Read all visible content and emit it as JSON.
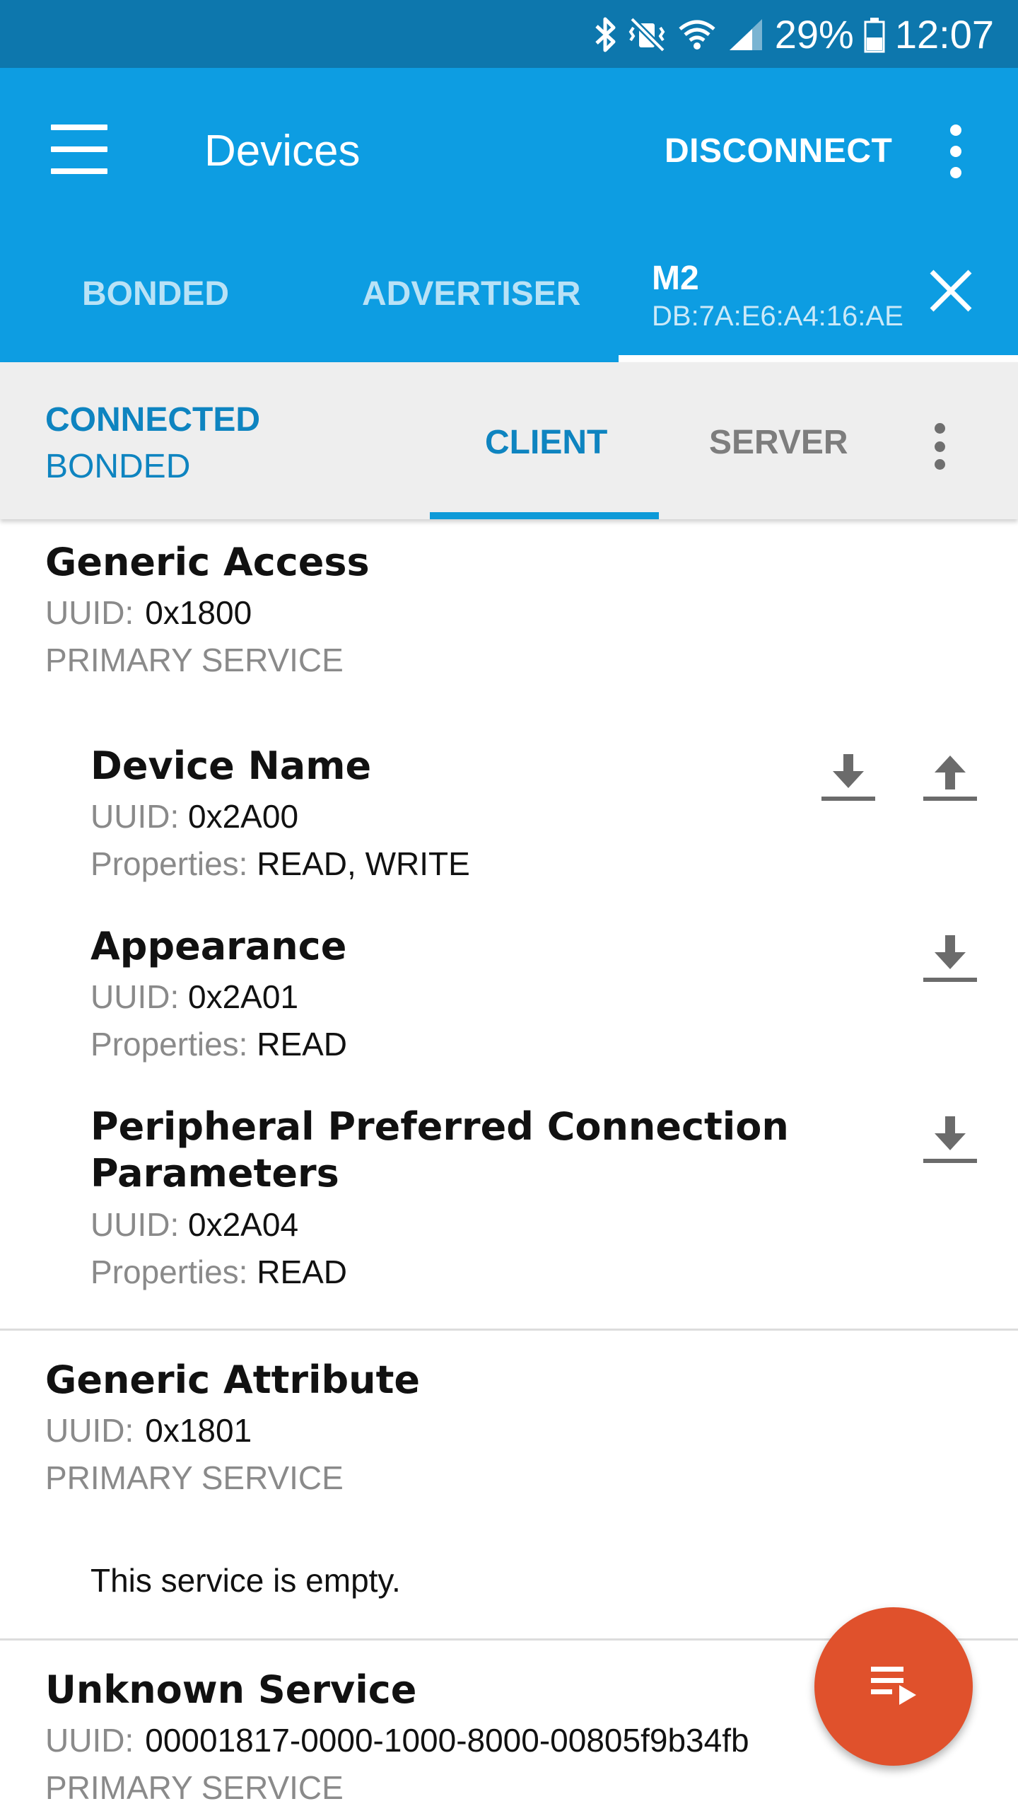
{
  "status_bar": {
    "battery": "29%",
    "time": "12:07",
    "icons": [
      "bluetooth-icon",
      "vibrate-icon",
      "wifi-icon",
      "cell-signal-icon",
      "battery-icon"
    ]
  },
  "app_bar": {
    "title": "Devices",
    "disconnect_label": "DISCONNECT",
    "tabs": [
      {
        "label": "BONDED"
      },
      {
        "label": "ADVERTISER"
      }
    ],
    "device_tab": {
      "name": "M2",
      "address": "DB:7A:E6:A4:16:AE"
    }
  },
  "connection": {
    "state": "CONNECTED",
    "bond_state": "BONDED",
    "tabs": [
      {
        "label": "CLIENT",
        "selected": true
      },
      {
        "label": "SERVER",
        "selected": false
      }
    ]
  },
  "services": [
    {
      "name": "Generic Access",
      "uuid_label": "UUID:",
      "uuid": "0x1800",
      "type": "PRIMARY SERVICE",
      "characteristics": [
        {
          "name": "Device Name",
          "uuid_label": "UUID:",
          "uuid": "0x2A00",
          "props_label": "Properties:",
          "props": "READ, WRITE"
        },
        {
          "name": "Appearance",
          "uuid_label": "UUID:",
          "uuid": "0x2A01",
          "props_label": "Properties:",
          "props": "READ"
        },
        {
          "name_line1": "Peripheral Preferred Connection",
          "name_line2": "Parameters",
          "uuid_label": "UUID:",
          "uuid": "0x2A04",
          "props_label": "Properties:",
          "props": "READ"
        }
      ]
    },
    {
      "name": "Generic Attribute",
      "uuid_label": "UUID:",
      "uuid": "0x1801",
      "type": "PRIMARY SERVICE",
      "empty_message": "This service is empty."
    },
    {
      "name": "Unknown Service",
      "uuid_label": "UUID:",
      "uuid": "00001817-0000-1000-8000-00805f9b34fb",
      "type": "PRIMARY SERVICE"
    }
  ],
  "colors": {
    "status_bar": "#0d77ad",
    "app_bar": "#0d9de2",
    "accent": "#0e84c0",
    "fab": "#e0512c"
  }
}
